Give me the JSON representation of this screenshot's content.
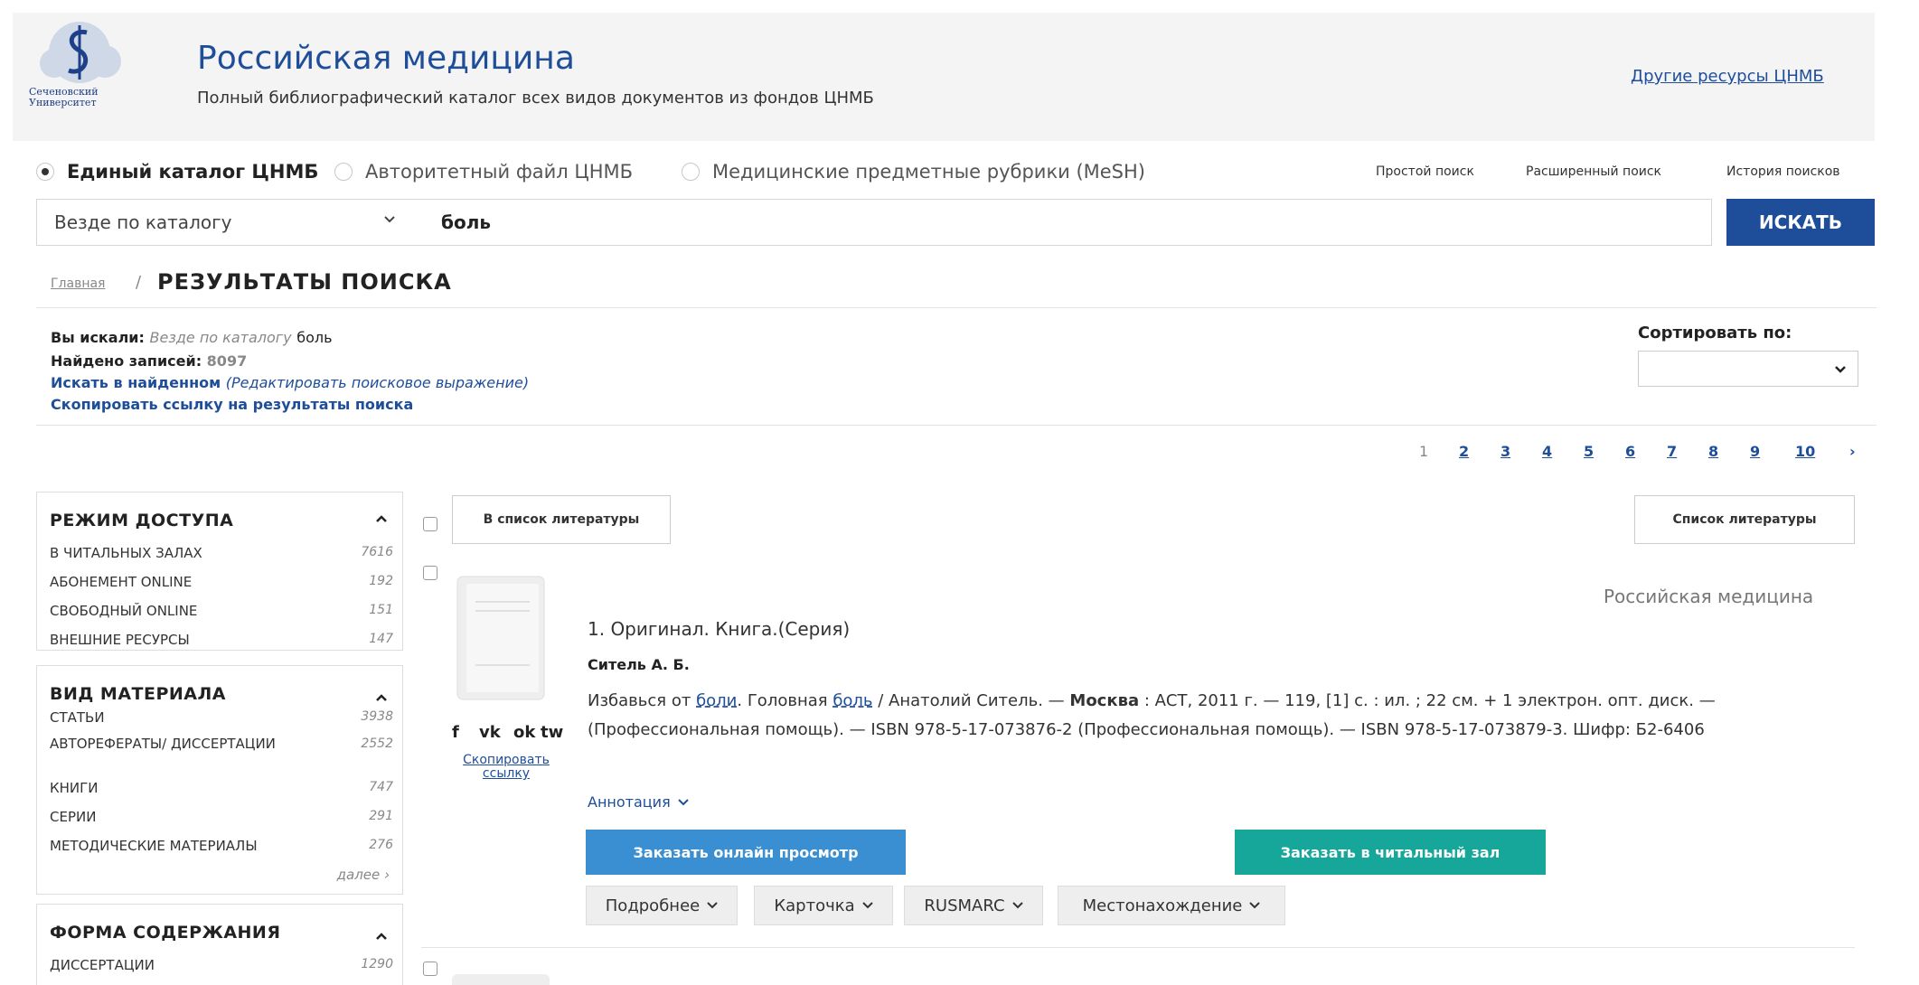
{
  "header": {
    "logo_text_line1": "Сеченовский",
    "logo_text_line2": "Университет",
    "title": "Российская медицина",
    "subtitle": "Полный библиографический каталог всех видов документов из фондов ЦНМБ",
    "other_resources": "Другие ресурсы ЦНМБ"
  },
  "catalogs": [
    {
      "label": "Единый каталог ЦНМБ",
      "selected": true
    },
    {
      "label": "Авторитетный файл ЦНМБ",
      "selected": false
    },
    {
      "label": "Медицинские предметные рубрики (MeSH)",
      "selected": false
    }
  ],
  "search_links": {
    "simple": "Простой поиск",
    "advanced": "Расширенный поиск",
    "history": "История поисков"
  },
  "search": {
    "scope": "Везде по каталогу",
    "query": "боль",
    "button": "ИСКАТЬ"
  },
  "breadcrumb": {
    "home": "Главная",
    "separator": "/",
    "current": "РЕЗУЛЬТАТЫ ПОИСКА"
  },
  "summary": {
    "searched_label": "Вы искали:",
    "searched_scope": "Везде по каталогу",
    "searched_query": "боль",
    "found_label": "Найдено записей:",
    "found_count": "8097",
    "refine_link": "Искать в найденном",
    "refine_edit": "(Редактировать поисковое выражение)",
    "copy_link": "Скопировать ссылку на результаты поиска"
  },
  "sort": {
    "label": "Сортировать по:",
    "value": ""
  },
  "pagination": {
    "current": "1",
    "pages": [
      "2",
      "3",
      "4",
      "5",
      "6",
      "7",
      "8",
      "9",
      "10"
    ],
    "next": "›"
  },
  "facets": [
    {
      "title": "РЕЖИМ ДОСТУПА",
      "items": [
        {
          "label": "В ЧИТАЛЬНЫХ ЗАЛАХ",
          "count": "7616"
        },
        {
          "label": "АБОНЕМЕНТ ONLINE",
          "count": "192"
        },
        {
          "label": "СВОБОДНЫЙ ONLINE",
          "count": "151"
        },
        {
          "label": "ВНЕШНИЕ РЕСУРСЫ",
          "count": "147"
        }
      ]
    },
    {
      "title": "ВИД МАТЕРИАЛА",
      "items": [
        {
          "label": "СТАТЬИ",
          "count": "3938"
        },
        {
          "label": "АВТОРЕФЕРАТЫ/ ДИССЕРТАЦИИ",
          "count": "2552"
        },
        {
          "label": "КНИГИ",
          "count": "747"
        },
        {
          "label": "СЕРИИ",
          "count": "291"
        },
        {
          "label": "МЕТОДИЧЕСКИЕ МАТЕРИАЛЫ",
          "count": "276"
        }
      ],
      "more": "далее ›"
    },
    {
      "title": "ФОРМА СОДЕРЖАНИЯ",
      "items": [
        {
          "label": "ДИССЕРТАЦИИ",
          "count": "1290"
        }
      ]
    }
  ],
  "results_toolbar": {
    "add_to_list": "В список литературы",
    "list": "Список литературы"
  },
  "record": {
    "source": "Российская медицина",
    "title": "1. Оригинал. Книга.(Серия)",
    "author": "Ситель А. Б.",
    "desc": {
      "p1": "Избавься от ",
      "kw1": "боли",
      "p2": ". Головная ",
      "kw2": "боль",
      "p3": " / Анатолий Ситель. — ",
      "b1": "Москва",
      "p4": " : АСТ, 2011 г. — 119, [1] с. : ил. ; 22 см. + 1 электрон. опт. диск. — (Профессиональная помощь). — ISBN 978-5-17-073876-2 (Профессиональная помощь). — ISBN 978-5-17-073879-3. Шифр: Б2-6406"
    },
    "share": {
      "f": "f",
      "vk": "vk",
      "ok": "ok",
      "tw": "tw"
    },
    "copy_link": "Скопировать ссылку",
    "annotation": "Аннотация",
    "order_online": "Заказать онлайн просмотр",
    "order_reading": "Заказать в читальный зал",
    "tabs": [
      "Подробнее",
      "Карточка",
      "RUSMARC",
      "Местонахождение"
    ]
  },
  "colors": {
    "brand": "#1e4e9a",
    "online_btn": "#3a8fd3",
    "reading_btn": "#17a79a"
  }
}
